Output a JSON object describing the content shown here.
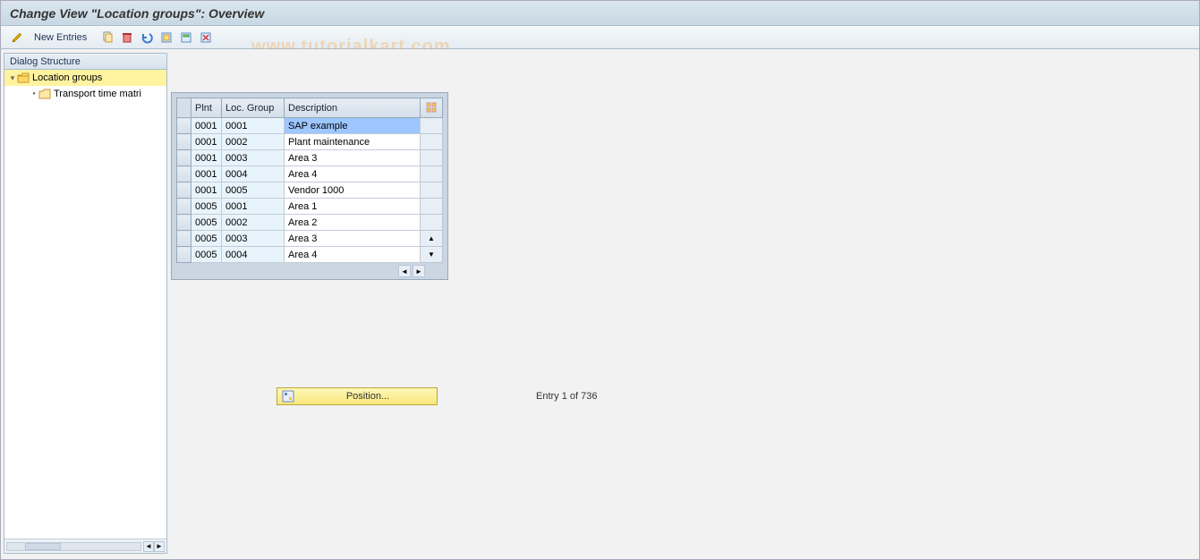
{
  "title": "Change View \"Location groups\": Overview",
  "toolbar": {
    "new_entries_label": "New Entries"
  },
  "watermark": "www.tutorialkart.com",
  "sidebar": {
    "header": "Dialog Structure",
    "items": [
      {
        "label": "Location groups"
      },
      {
        "label": "Transport time matri"
      }
    ]
  },
  "table": {
    "columns": {
      "plnt": "Plnt",
      "locgroup": "Loc. Group",
      "description": "Description"
    },
    "rows": [
      {
        "plnt": "0001",
        "loc": "0001",
        "desc": "SAP example",
        "selected": true
      },
      {
        "plnt": "0001",
        "loc": "0002",
        "desc": "Plant maintenance",
        "selected": false
      },
      {
        "plnt": "0001",
        "loc": "0003",
        "desc": "Area 3",
        "selected": false
      },
      {
        "plnt": "0001",
        "loc": "0004",
        "desc": "Area 4",
        "selected": false
      },
      {
        "plnt": "0001",
        "loc": "0005",
        "desc": "Vendor 1000",
        "selected": false
      },
      {
        "plnt": "0005",
        "loc": "0001",
        "desc": "Area 1",
        "selected": false
      },
      {
        "plnt": "0005",
        "loc": "0002",
        "desc": "Area 2",
        "selected": false
      },
      {
        "plnt": "0005",
        "loc": "0003",
        "desc": "Area 3",
        "selected": false
      },
      {
        "plnt": "0005",
        "loc": "0004",
        "desc": "Area 4",
        "selected": false
      }
    ]
  },
  "position_button": "Position...",
  "entry_status": "Entry 1 of 736",
  "colors": {
    "accent_yellow": "#fff3a0",
    "highlight_blue": "#9ec6ff"
  }
}
